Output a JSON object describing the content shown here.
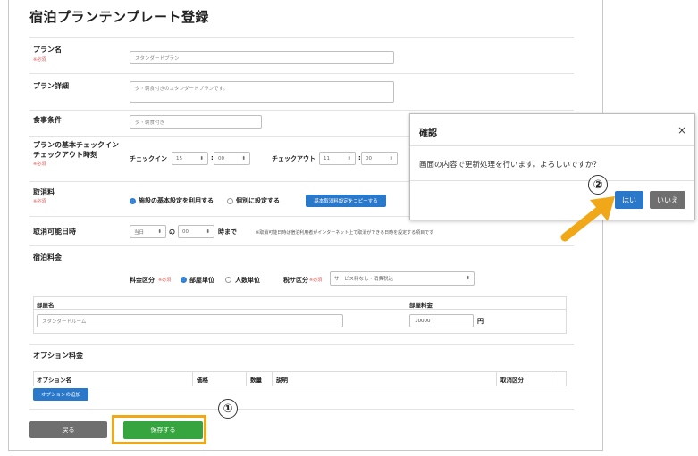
{
  "page_title": "宿泊プランテンプレート登録",
  "required_mark": "※必須",
  "plan_name": {
    "label": "プラン名",
    "value": "スタンダードプラン"
  },
  "plan_detail": {
    "label": "プラン詳細",
    "value": "夕・朝食付きのスタンダードプランです。"
  },
  "meal": {
    "label": "食事条件",
    "value": "夕・朝食付き"
  },
  "checkin": {
    "label_line1": "プランの基本チェックイン",
    "label_line2": "チェックアウト時刻",
    "checkin_label": "チェックイン",
    "checkin_hour": "15",
    "checkin_min": "00",
    "checkout_label": "チェックアウト",
    "checkout_hour": "11",
    "checkout_min": "00",
    "colon": ":"
  },
  "cancel_fee": {
    "label": "取消料",
    "option1": "施設の基本設定を利用する",
    "option2": "個別に設定する",
    "copy_button": "基本取消料設定をコピーする"
  },
  "cancel_date": {
    "label": "取消可能日時",
    "day": "当日",
    "of": "の",
    "time": "00",
    "until": "時まで",
    "note": "※取消可能日時は宿泊利用者がインターネット上で取消ができる日時を設定する項目です"
  },
  "fee": {
    "label": "宿泊料金",
    "fee_type_label": "料金区分",
    "opt_room": "部屋単位",
    "opt_person": "人数単位",
    "tax_label": "税サ区分",
    "tax_value": "サービス料なし・消費税込"
  },
  "room_table": {
    "col_name": "部屋名",
    "col_price": "部屋料金",
    "name_value": "スタンダードルーム",
    "price_value": "10000",
    "yen": "円"
  },
  "option_fee": {
    "label": "オプション料金",
    "col_name": "オプション名",
    "col_price": "価格",
    "col_qty": "数量",
    "col_desc": "説明",
    "col_cancel": "取消区分",
    "add_button": "オプションの追加"
  },
  "footer": {
    "back": "戻る",
    "save": "保存する"
  },
  "modal": {
    "title": "確認",
    "close": "×",
    "message": "画面の内容で更新処理を行います。よろしいですか？",
    "yes": "はい",
    "no": "いいえ"
  },
  "callouts": {
    "one": "①",
    "two": "②"
  },
  "colors": {
    "highlight": "#f0a818",
    "save_green": "#36a53f",
    "primary_blue": "#2a78c9"
  }
}
